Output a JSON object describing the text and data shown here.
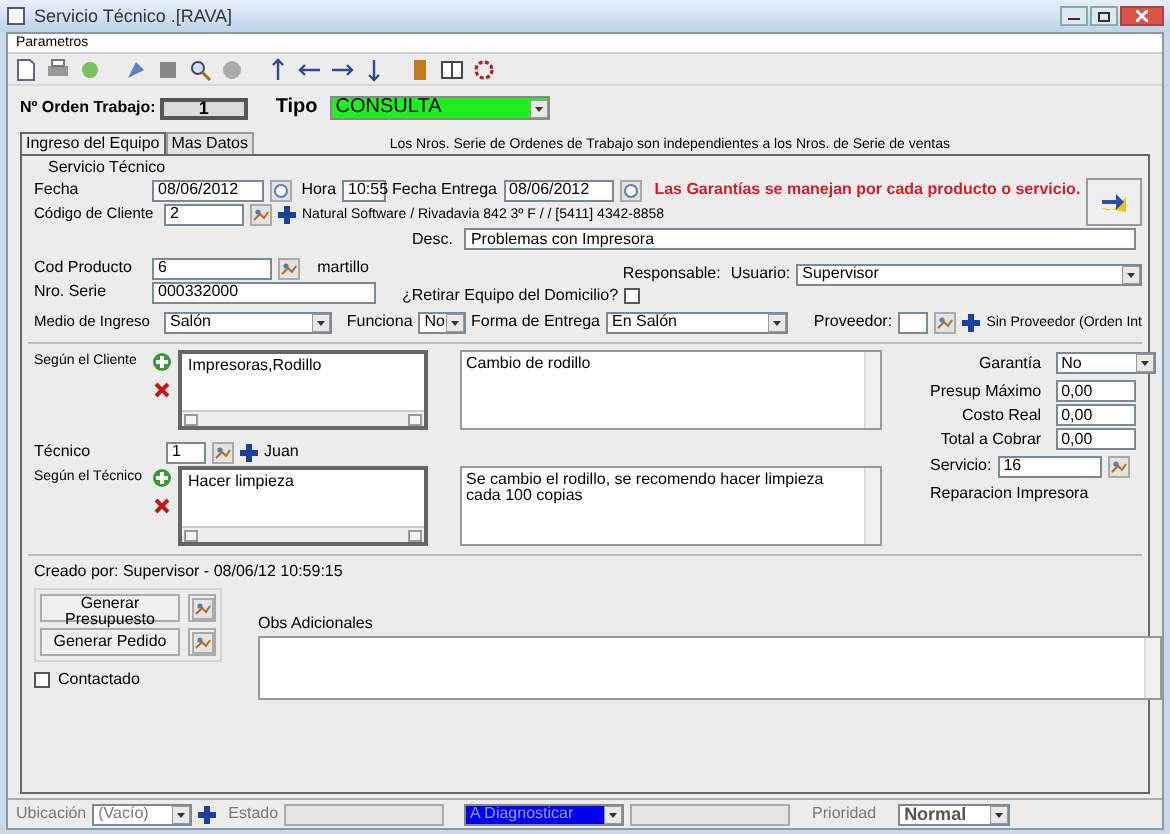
{
  "window": {
    "title": "Servicio Técnico .[RAVA]"
  },
  "menu": [
    {
      "label": "Parametros"
    }
  ],
  "order": {
    "label": "Nº Orden Trabajo:",
    "value": "1"
  },
  "tipo": {
    "label": "Tipo",
    "value": "CONSULTA"
  },
  "tabs": [
    {
      "label": "Ingreso del Equipo",
      "selected": true
    },
    {
      "label": "Mas Datos",
      "selected": false
    }
  ],
  "notice": "Los Nros. Serie de Ordenes de Trabajo son independientes a los Nros. de Serie de ventas",
  "group_title": "Servicio Técnico",
  "fecha": {
    "label": "Fecha",
    "value": "08/06/2012"
  },
  "hora": {
    "label": "Hora",
    "value": "10:55"
  },
  "fecha_entrega": {
    "label": "Fecha Entrega",
    "value": "08/06/2012"
  },
  "warning": "Las Garantías se manejan por cada producto o servicio.",
  "codigo_cliente": {
    "label": "Código de Cliente",
    "value": "2",
    "info": "Natural Software / Rivadavia 842 3º F /  / [5411] 4342-8858"
  },
  "desc": {
    "label": "Desc.",
    "value": "Problemas con Impresora"
  },
  "cod_producto": {
    "label": "Cod Producto",
    "value": "6",
    "info": "martillo"
  },
  "responsable": {
    "label": "Responsable:",
    "user_label": "Usuario:",
    "value": "Supervisor"
  },
  "nro_serie": {
    "label": "Nro. Serie",
    "value": "000332000"
  },
  "retirar": {
    "label": "¿Retirar Equipo del Domicilio?",
    "checked": false
  },
  "medio": {
    "label": "Medio de Ingreso",
    "value": "Salón"
  },
  "funciona": {
    "label": "Funciona",
    "value": "No"
  },
  "forma_entrega": {
    "label": "Forma de Entrega",
    "value": "En Salón"
  },
  "proveedor": {
    "label": "Proveedor:",
    "info": "Sin Proveedor (Orden Int"
  },
  "segun_cliente": {
    "label": "Según el Cliente",
    "list": [
      "Impresoras,Rodillo"
    ],
    "note": "Cambio de rodillo"
  },
  "tecnico": {
    "label": "Técnico",
    "value": "1",
    "info": "Juan"
  },
  "segun_tecnico": {
    "label": "Según el Técnico",
    "list": [
      "Hacer limpieza"
    ],
    "note": "Se cambio el rodillo, se recomendo hacer limpieza cada 100 copias"
  },
  "costs": [
    {
      "label": "Garantía",
      "value": "No",
      "kind": "select"
    },
    {
      "label": "Presup Máximo",
      "value": "0,00",
      "kind": "input"
    },
    {
      "label": "Costo Real",
      "value": "0,00",
      "kind": "input"
    },
    {
      "label": "Total a Cobrar",
      "value": "0,00",
      "kind": "input"
    }
  ],
  "servicio": {
    "label": "Servicio:",
    "value": "16",
    "info": "Reparacion Impresora"
  },
  "created": "Creado por: Supervisor - 08/06/12 10:59:15",
  "buttons": [
    {
      "label": "Generar Presupuesto"
    },
    {
      "label": "Generar Pedido"
    }
  ],
  "obs": {
    "label": "Obs Adicionales"
  },
  "contactado": {
    "label": "Contactado",
    "checked": false
  },
  "status": {
    "ubicacion": {
      "label": "Ubicación",
      "value": "(Vacío)"
    },
    "estado": {
      "label": "Estado",
      "value": "A Diagnosticar"
    },
    "prioridad": {
      "label": "Prioridad",
      "value": "Normal"
    }
  }
}
